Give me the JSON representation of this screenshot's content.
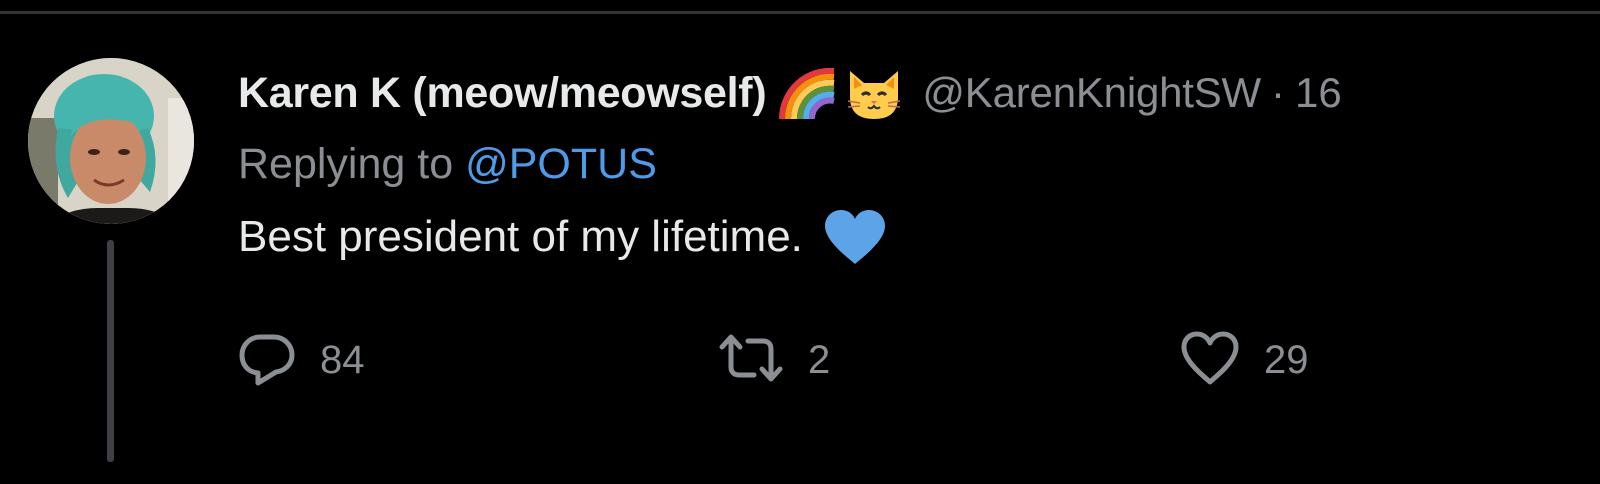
{
  "tweet": {
    "display_name": "Karen K (meow/meowself)",
    "name_emojis": [
      "rainbow-emoji",
      "cat-face-emoji"
    ],
    "handle": "@KarenKnightSW",
    "separator": "·",
    "timestamp": "16",
    "reply_prefix": "Replying to",
    "reply_to": "@POTUS",
    "text": "Best president of my lifetime.",
    "text_emoji": "blue-heart-emoji"
  },
  "actions": {
    "reply": {
      "icon": "reply-icon",
      "count": "84"
    },
    "retweet": {
      "icon": "retweet-icon",
      "count": "2"
    },
    "like": {
      "icon": "heart-outline-icon",
      "count": "29"
    }
  },
  "colors": {
    "background": "#000000",
    "primary_text": "#e7e9ea",
    "secondary_text": "#8b8f93",
    "link": "#4f9be9",
    "divider": "#2f3336",
    "thread_line": "#3e4144",
    "blue_heart": "#5da3e8"
  }
}
